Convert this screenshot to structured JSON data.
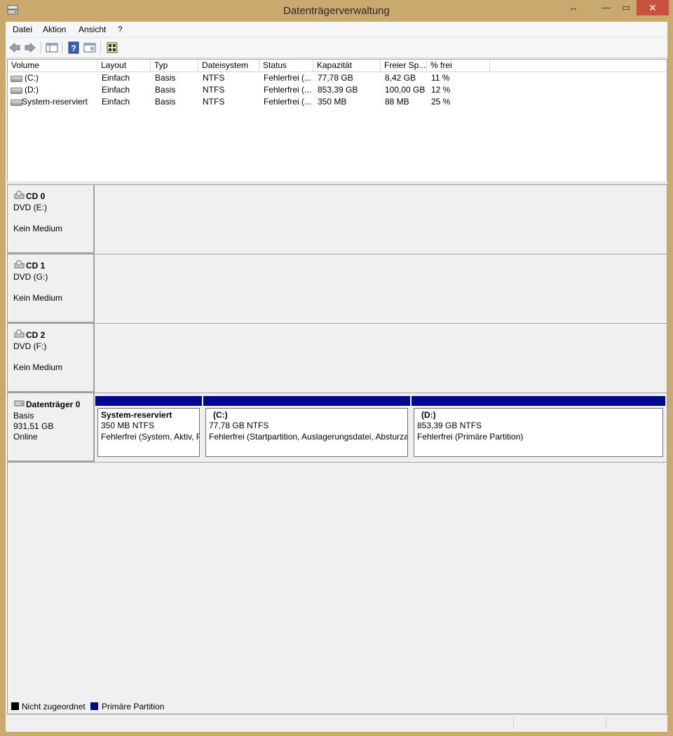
{
  "window": {
    "title": "Datenträgerverwaltung"
  },
  "menu": [
    "Datei",
    "Aktion",
    "Ansicht",
    "?"
  ],
  "toolbar_icons": [
    "back-arrow-icon",
    "forward-arrow-icon",
    "console-tree-icon",
    "help-icon",
    "properties-icon",
    "disk-refresh-icon"
  ],
  "volume_table": {
    "columns": [
      "Volume",
      "Layout",
      "Typ",
      "Dateisystem",
      "Status",
      "Kapazität",
      "Freier Sp...",
      "% frei"
    ],
    "rows": [
      [
        "(C:)",
        "Einfach",
        "Basis",
        "NTFS",
        "Fehlerfrei (...",
        "77,78 GB",
        "8,42 GB",
        "11 %"
      ],
      [
        "(D:)",
        "Einfach",
        "Basis",
        "NTFS",
        "Fehlerfrei (...",
        "853,39 GB",
        "100,00 GB",
        "12 %"
      ],
      [
        "System-reserviert",
        "Einfach",
        "Basis",
        "NTFS",
        "Fehlerfrei (...",
        "350 MB",
        "88 MB",
        "25 %"
      ]
    ]
  },
  "disks": [
    {
      "name": "CD 0",
      "line1": "DVD (E:)",
      "line2": "",
      "line3": "Kein Medium"
    },
    {
      "name": "CD 1",
      "line1": "DVD (G:)",
      "line2": "",
      "line3": "Kein Medium"
    },
    {
      "name": "CD 2",
      "line1": "DVD (F:)",
      "line2": "",
      "line3": "Kein Medium"
    },
    {
      "name": "Datenträger 0",
      "line1": "Basis",
      "line2": "931,51 GB",
      "line3": "Online"
    }
  ],
  "partitions": [
    {
      "name": "System-reserviert",
      "size": "350 MB NTFS",
      "status": "Fehlerfrei (System, Aktiv, P"
    },
    {
      "name": "(C:)",
      "size": "77,78 GB NTFS",
      "status": "Fehlerfrei (Startpartition, Auslagerungsdatei, Absturza"
    },
    {
      "name": "(D:)",
      "size": "853,39 GB NTFS",
      "status": "Fehlerfrei (Primäre Partition)"
    }
  ],
  "legend": [
    {
      "label": "Nicht zugeordnet",
      "color": "#000000"
    },
    {
      "label": "Primäre Partition",
      "color": "#000a8a"
    }
  ],
  "colors": {
    "frame": "#c9a96e",
    "close": "#c7503e",
    "primary_partition": "#000a8a"
  }
}
